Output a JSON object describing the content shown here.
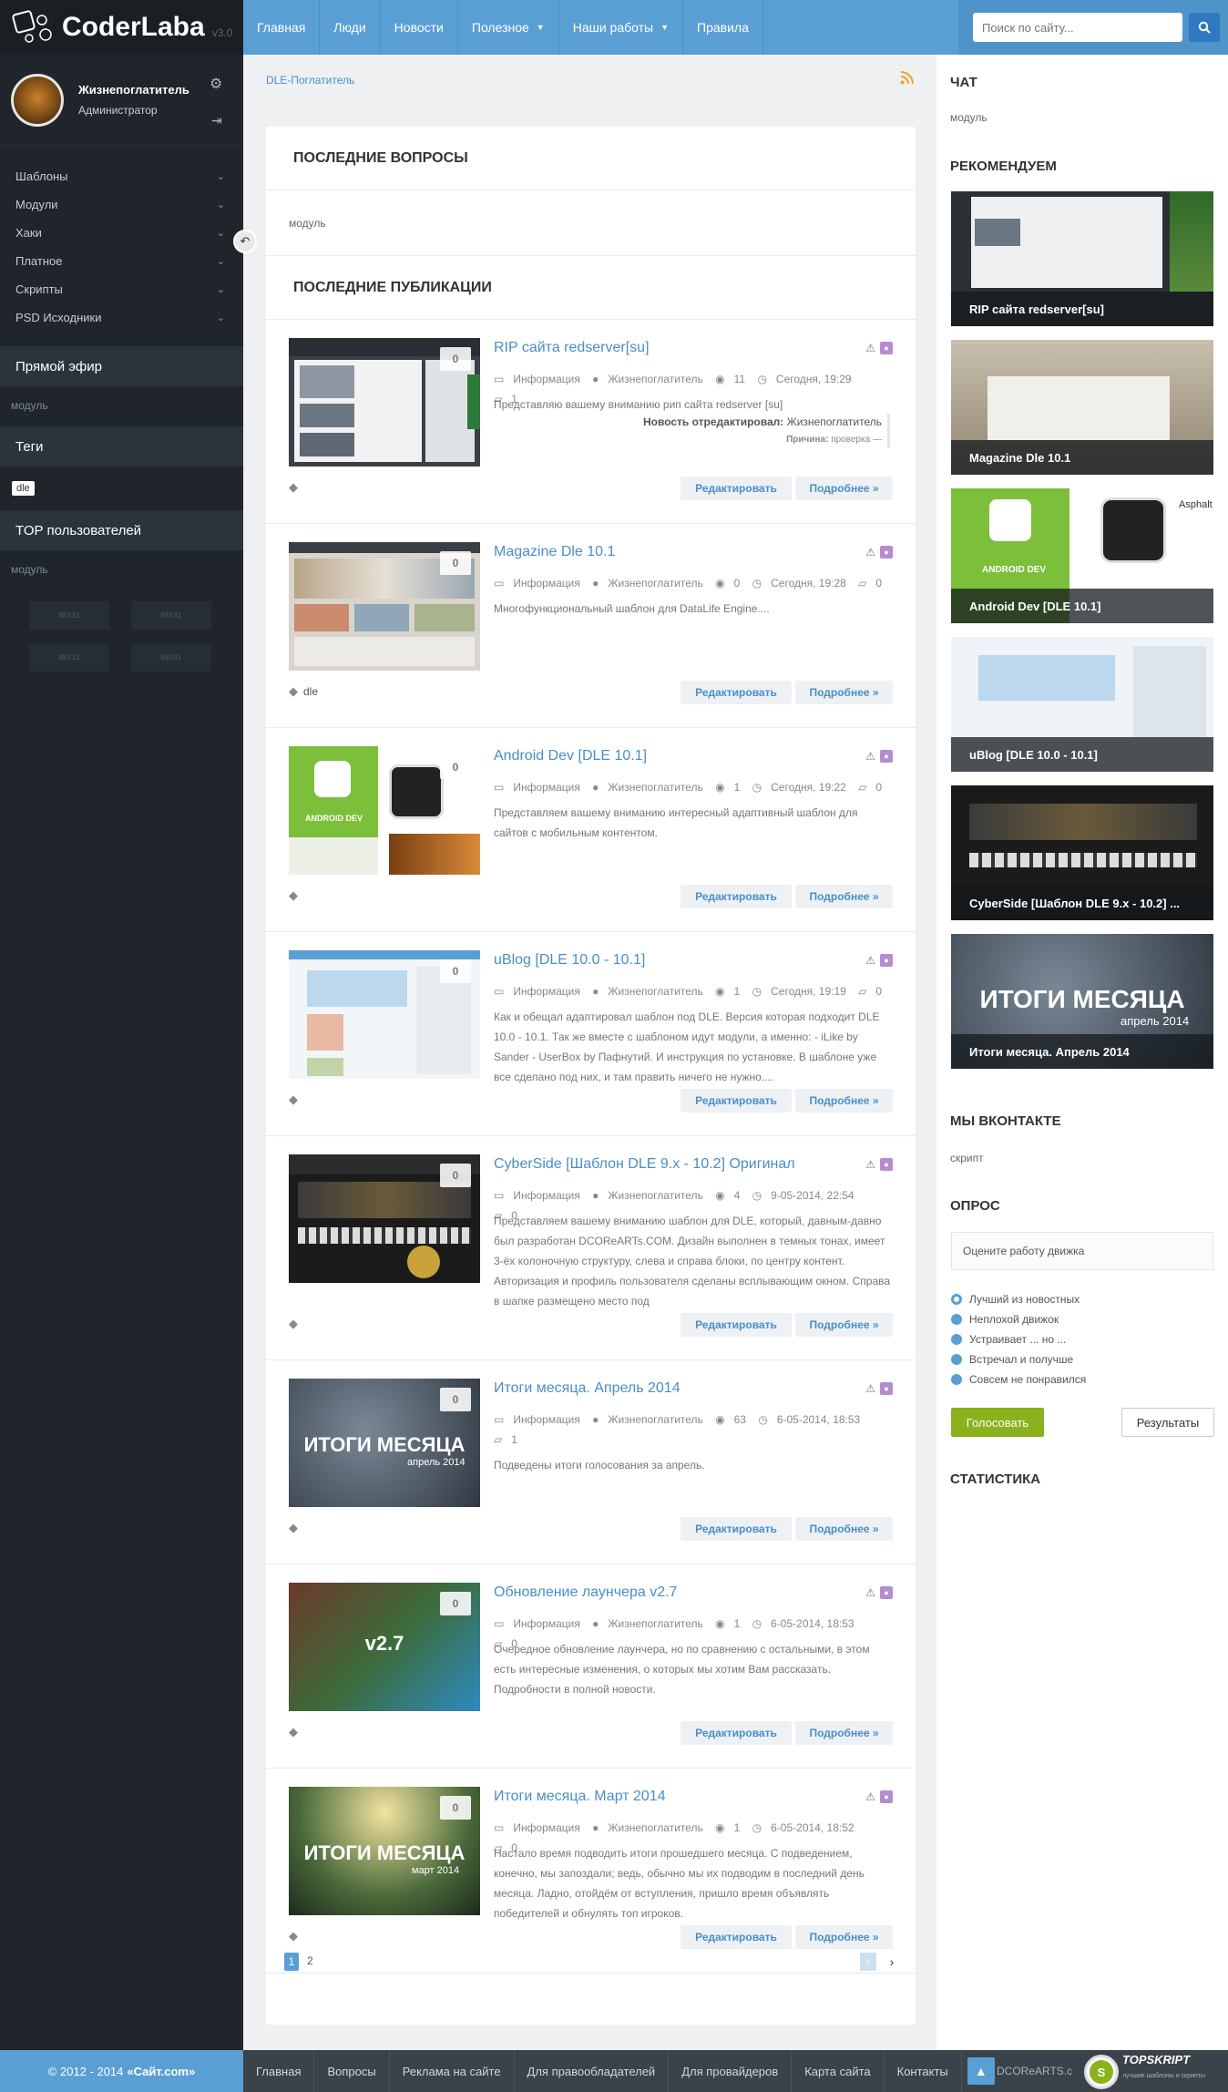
{
  "logo": {
    "name": "CoderLaba",
    "version": "v3.0",
    "mark": "DLE"
  },
  "user": {
    "name": "Жизнепоглатитель",
    "role": "Администратор"
  },
  "sidebar": {
    "menu": [
      {
        "label": "Шаблоны"
      },
      {
        "label": "Модули"
      },
      {
        "label": "Хаки"
      },
      {
        "label": "Платное"
      },
      {
        "label": "Скрипты"
      },
      {
        "label": "PSD Исходники"
      }
    ],
    "live": {
      "title": "Прямой эфир",
      "text": "модуль"
    },
    "tags": {
      "title": "Теги",
      "tag": "dle"
    },
    "top_users": {
      "title": "TOP пользователей",
      "text": "модуль"
    },
    "counters": [
      "88X31",
      "88X31",
      "88X31",
      "88X31"
    ]
  },
  "nav": {
    "items": [
      {
        "label": "Главная"
      },
      {
        "label": "Люди"
      },
      {
        "label": "Новости"
      },
      {
        "label": "Полезное",
        "dropdown": true
      },
      {
        "label": "Наши работы",
        "dropdown": true
      },
      {
        "label": "Правила"
      }
    ],
    "search_placeholder": "Поиск по сайту..."
  },
  "breadcrumb": "DLE-Поглатитель",
  "sections": {
    "questions": {
      "title": "ПОСЛЕДНИЕ ВОПРОСЫ",
      "text": "модуль"
    },
    "publications": {
      "title": "ПОСЛЕДНИЕ ПУБЛИКАЦИИ"
    }
  },
  "posts": [
    {
      "title": "RIP сайта redserver[su]",
      "category": "Информация",
      "author": "Жизнепоглатитель",
      "views": "11",
      "date": "Сегодня, 19:29",
      "comments": "1",
      "count": "0",
      "excerpt": "Представляю вашему вниманию рип сайта redserver [su]",
      "edited_label": "Новость отредактировал:",
      "edited_by": "Жизнепоглатитель",
      "reason_label": "Причина:",
      "reason": "проверка —",
      "tags": "",
      "edit_label": "Редактировать",
      "more_label": "Подробнее »"
    },
    {
      "title": "Magazine Dle 10.1",
      "category": "Информация",
      "author": "Жизнепоглатитель",
      "views": "0",
      "date": "Сегодня, 19:28",
      "comments": "0",
      "count": "0",
      "excerpt": "Многофункциональный шаблон для DataLife Engine....",
      "tags": "dle",
      "edit_label": "Редактировать",
      "more_label": "Подробнее »"
    },
    {
      "title": "Android Dev [DLE 10.1]",
      "category": "Информация",
      "author": "Жизнепоглатитель",
      "views": "1",
      "date": "Сегодня, 19:22",
      "comments": "0",
      "count": "0",
      "excerpt": "Представляем вашему вниманию интересный адаптивный шаблон для сайтов с мобильным контентом.",
      "tags": "",
      "edit_label": "Редактировать",
      "more_label": "Подробнее »"
    },
    {
      "title": "uBlog [DLE 10.0 - 10.1]",
      "category": "Информация",
      "author": "Жизнепоглатитель",
      "views": "1",
      "date": "Сегодня, 19:19",
      "comments": "0",
      "count": "0",
      "excerpt": "Как и обещал адаптировал шаблон под DLE. Версия которая подходит DLE 10.0 - 10.1. Так же вместе с шаблоном идут модули, а именно: - iLike by Sander - UserBox by Пафнутий. И инструкция по установке. В шаблоне уже все сделано под них, и там править ничего не нужно....",
      "tags": "",
      "edit_label": "Редактировать",
      "more_label": "Подробнее »"
    },
    {
      "title": "CyberSide [Шаблон DLE 9.x - 10.2] Оригинал",
      "category": "Информация",
      "author": "Жизнепоглатитель",
      "views": "4",
      "date": "9-05-2014, 22:54",
      "comments": "0",
      "count": "0",
      "excerpt": "Представляем вашему вниманию шаблон для DLE, который, давным-давно был разработан DCOReARTs.COM. Дизайн выполнен в темных тонах, имеет 3-ёх колоночную структуру, слева и справа блоки, по центру контент. Авторизация и профиль пользователя сделаны всплывающим окном. Справа в шапке размещено место под",
      "tags": "",
      "edit_label": "Редактировать",
      "more_label": "Подробнее »"
    },
    {
      "title": "Итоги месяца. Апрель 2014",
      "category": "Информация",
      "author": "Жизнепоглатитель",
      "views": "63",
      "date": "6-05-2014, 18:53",
      "comments": "1",
      "count": "0",
      "excerpt": "Подведены итоги голосования за апрель.",
      "thumb_line1": "ИТОГИ МЕСЯЦА",
      "thumb_line2": "апрель 2014",
      "tags": "",
      "edit_label": "Редактировать",
      "more_label": "Подробнее »"
    },
    {
      "title": "Обновление лаунчера v2.7",
      "category": "Информация",
      "author": "Жизнепоглатитель",
      "views": "1",
      "date": "6-05-2014, 18:53",
      "comments": "0",
      "count": "0",
      "excerpt": "Очередное обновление лаунчера, но по сравнению с остальными, в этом есть интересные изменения, о которых мы хотим Вам рассказать. Подробности в полной новости.",
      "thumb_line1": "v2.7",
      "tags": "",
      "edit_label": "Редактировать",
      "more_label": "Подробнее »"
    },
    {
      "title": "Итоги месяца. Март 2014",
      "category": "Информация",
      "author": "Жизнепоглатитель",
      "views": "1",
      "date": "6-05-2014, 18:52",
      "comments": "0",
      "count": "0",
      "excerpt": "Настало время подводить итоги прошедшего месяца. С подведением, конечно, мы запоздали; ведь, обычно мы их подводим в последний день месяца. Ладно, отойдём от вступления, пришло время объявлять победителей и обнулять топ игроков.",
      "thumb_line1": "ИТОГИ МЕСЯЦА",
      "thumb_line2": "март 2014",
      "tags": "",
      "edit_label": "Редактировать",
      "more_label": "Подробнее »"
    }
  ],
  "pagination": {
    "current": "1",
    "next": "2"
  },
  "right": {
    "chat": {
      "title": "ЧАТ",
      "text": "модуль"
    },
    "recommend": {
      "title": "РЕКОМЕНДУЕМ",
      "items": [
        {
          "caption": "RIP сайта redserver[su]"
        },
        {
          "caption": "Magazine Dle 10.1"
        },
        {
          "caption": "Android Dev [DLE 10.1]",
          "thumb_text": "ANDROID DEV",
          "thumb_text2": "Asphalt"
        },
        {
          "caption": "uBlog [DLE 10.0 - 10.1]"
        },
        {
          "caption": "CyberSide [Шаблон DLE 9.x - 10.2] ..."
        },
        {
          "caption": "Итоги месяца. Апрель 2014",
          "thumb_text": "ИТОГИ МЕСЯЦА",
          "thumb_text2": "апрель 2014"
        }
      ]
    },
    "vk": {
      "title": "МЫ ВКОНТАКТЕ",
      "text": "скрипт"
    },
    "poll": {
      "title": "ОПРОС",
      "question": "Оцените работу движка",
      "options": [
        "Лучший из новостных",
        "Неплохой движок",
        "Устраивает ... но ...",
        "Встречал и получше",
        "Совсем не понравился"
      ],
      "vote_label": "Голосовать",
      "results_label": "Результаты"
    },
    "stats": {
      "title": "СТАТИСТИКА"
    }
  },
  "footer": {
    "copyright": "© 2012 - 2014",
    "site": "«Сайт.com»",
    "links": [
      "Главная",
      "Вопросы",
      "Реклама на сайте",
      "Для правообладателей",
      "Для провайдеров",
      "Карта сайта",
      "Контакты"
    ],
    "credit": "DCOReARTS.c",
    "badge": "TOPSKRIPT",
    "badge_sub": "лучшие шаблоны и скрипты"
  },
  "colors": {
    "accent": "#5a9fd4",
    "sidebar": "#1f252b",
    "vote": "#8ab21c"
  }
}
